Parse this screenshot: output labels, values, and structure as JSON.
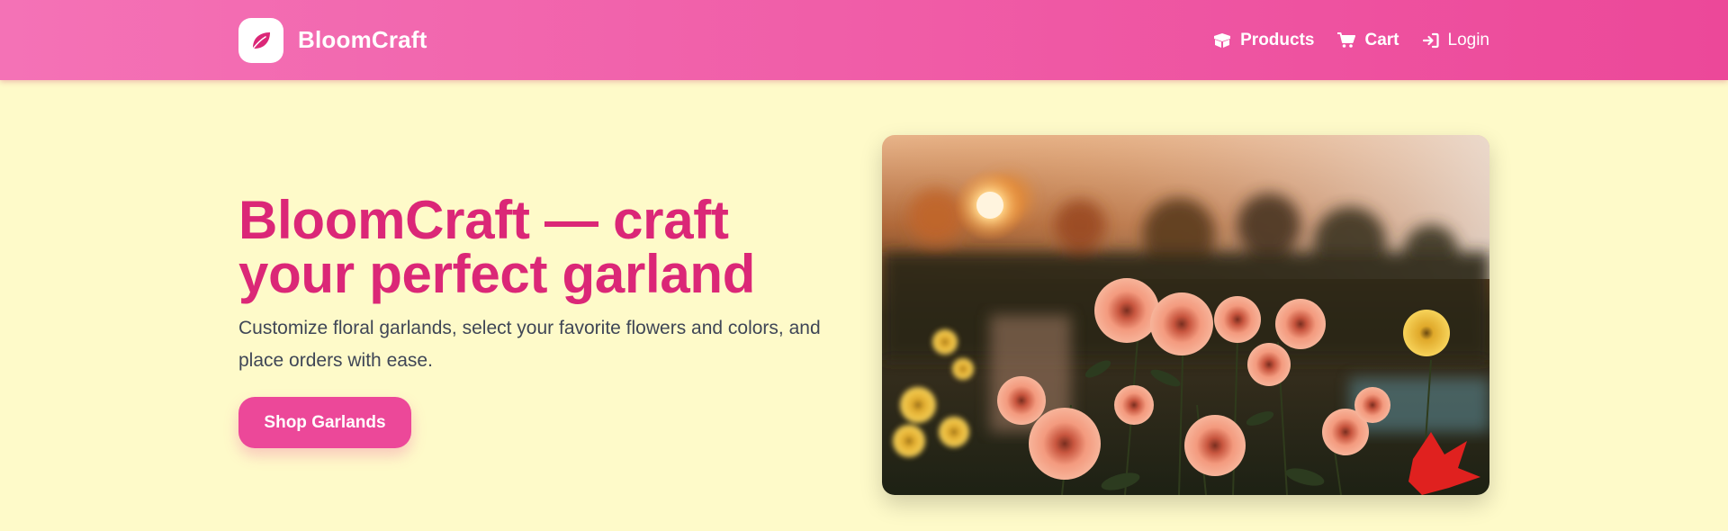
{
  "brand": {
    "name": "BloomCraft",
    "logo_icon": "leaf-icon",
    "color": "#db2777"
  },
  "nav": {
    "items": [
      {
        "label": "Products",
        "icon": "box-icon"
      },
      {
        "label": "Cart",
        "icon": "cart-icon"
      },
      {
        "label": "Login",
        "icon": "sign-in-icon"
      }
    ]
  },
  "hero": {
    "title": "BloomCraft — craft your perfect garland",
    "subtitle": "Customize floral garlands, select your favorite flowers and colors, and place orders with ease.",
    "cta_label": "Shop Garlands",
    "image_subject": "flowers-at-sunset-photo"
  },
  "colors": {
    "navbar_start": "#f472b6",
    "navbar_end": "#ec4899",
    "background": "#fefac9",
    "accent": "#db2777",
    "button": "#ec4899",
    "body_text": "#3f4656"
  }
}
